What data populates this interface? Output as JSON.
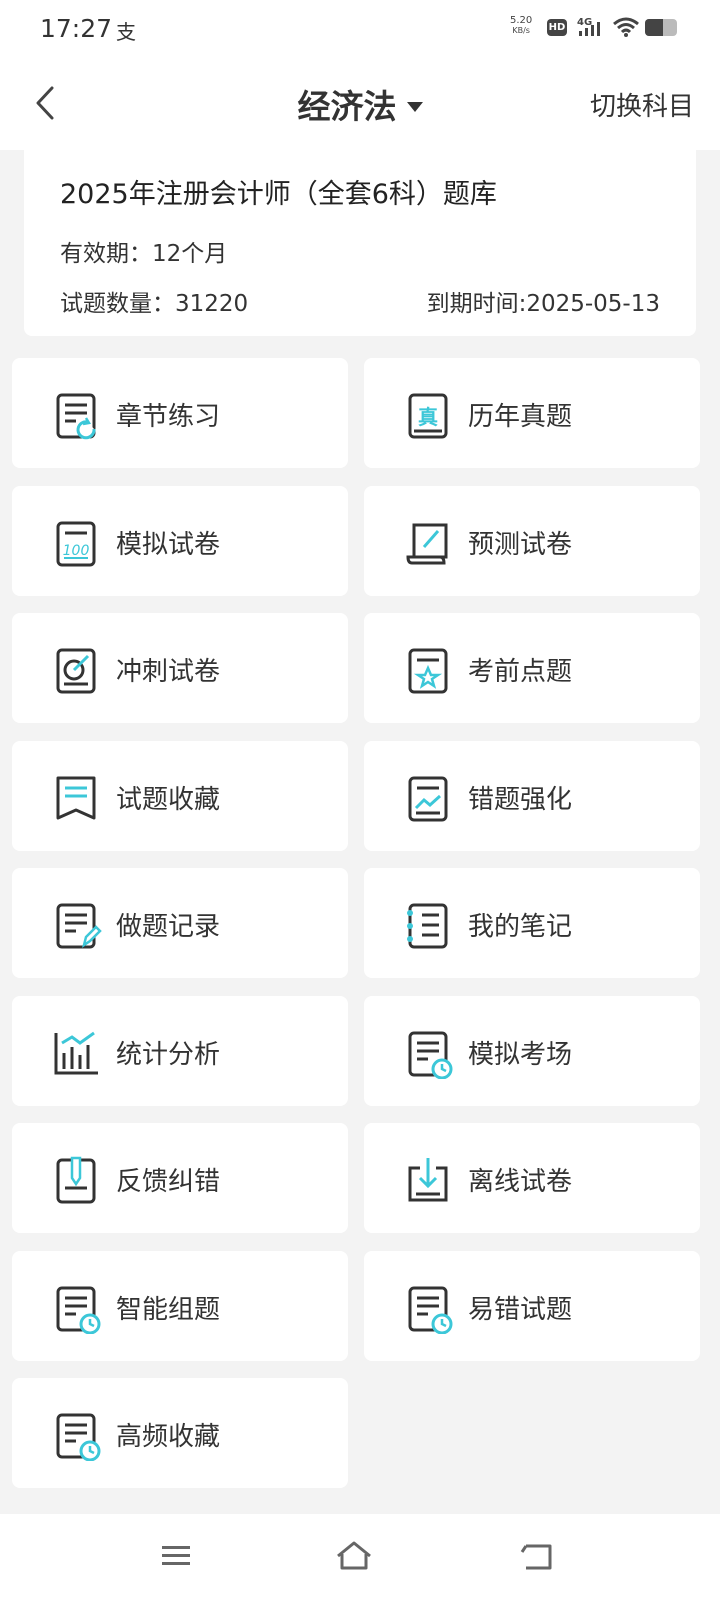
{
  "status_bar": {
    "time": "17:27",
    "app_glyph": "支",
    "speed_value": "5.20",
    "speed_unit": "KB/s",
    "hd": "HD",
    "network": "4G",
    "battery_level": 0.55
  },
  "header": {
    "subject": "经济法",
    "switch_label": "切换科目"
  },
  "info": {
    "title": "2025年注册会计师（全套6科）题库",
    "validity": "有效期：12个月",
    "count": "试题数量：31220",
    "expiry": "到期时间:2025-05-13"
  },
  "colors": {
    "accent": "#3cc7d8",
    "icon": "#333333",
    "tile_bg": "#ffffff",
    "page_bg": "#f3f3f3"
  },
  "menu": [
    {
      "label": "章节练习",
      "icon": "chapter-practice-icon"
    },
    {
      "label": "历年真题",
      "icon": "past-exam-icon"
    },
    {
      "label": "模拟试卷",
      "icon": "mock-paper-icon"
    },
    {
      "label": "预测试卷",
      "icon": "forecast-paper-icon"
    },
    {
      "label": "冲刺试卷",
      "icon": "sprint-paper-icon"
    },
    {
      "label": "考前点题",
      "icon": "pre-exam-tips-icon"
    },
    {
      "label": "试题收藏",
      "icon": "favorites-icon"
    },
    {
      "label": "错题强化",
      "icon": "wrong-questions-icon"
    },
    {
      "label": "做题记录",
      "icon": "practice-record-icon"
    },
    {
      "label": "我的笔记",
      "icon": "notes-icon"
    },
    {
      "label": "统计分析",
      "icon": "statistics-icon"
    },
    {
      "label": "模拟考场",
      "icon": "mock-exam-room-icon"
    },
    {
      "label": "反馈纠错",
      "icon": "feedback-icon"
    },
    {
      "label": "离线试卷",
      "icon": "offline-download-icon"
    },
    {
      "label": "智能组题",
      "icon": "smart-compose-icon"
    },
    {
      "label": "易错试题",
      "icon": "error-prone-icon"
    },
    {
      "label": "高频收藏",
      "icon": "high-frequency-icon"
    }
  ],
  "nav": {
    "menu_icon": "menu-icon",
    "home_icon": "home-icon",
    "back_icon": "back-nav-icon"
  }
}
